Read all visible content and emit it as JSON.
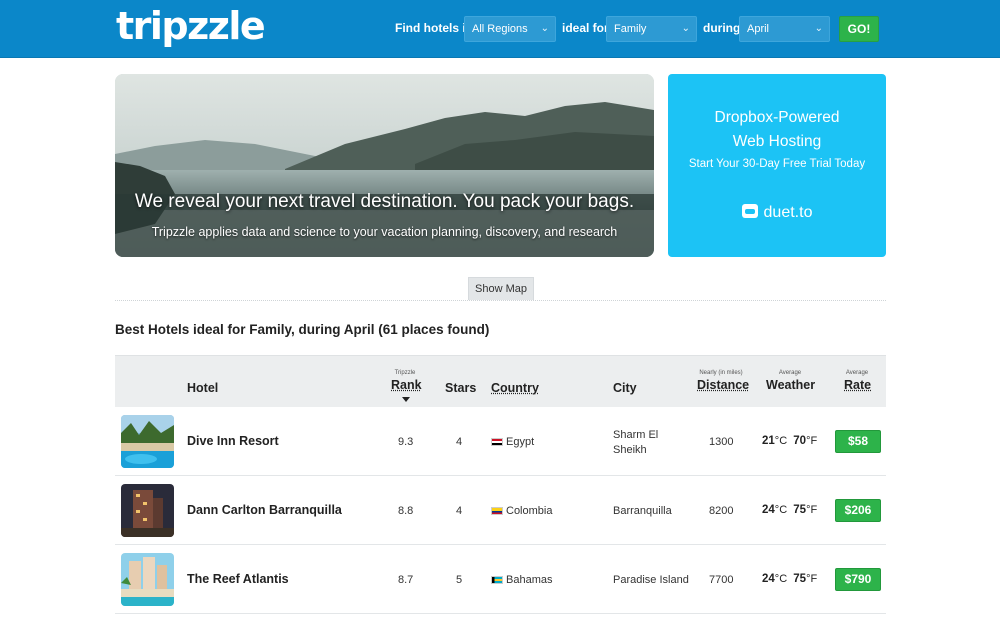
{
  "header": {
    "logo": "tripzzle",
    "find_label": "Find hotels in",
    "region_value": "All Regions",
    "ideal_label": "ideal for",
    "ideal_value": "Family",
    "during_label": "during",
    "month_value": "April",
    "go_label": "GO!"
  },
  "hero": {
    "title": "We reveal your next travel destination. You pack your bags.",
    "subtitle": "Tripzzle applies data and science to your vacation planning, discovery, and research"
  },
  "ad": {
    "title_line1": "Dropbox-Powered",
    "title_line2": "Web Hosting",
    "subtitle": "Start Your 30-Day Free Trial Today",
    "brand": "duet.to"
  },
  "show_map_label": "Show Map",
  "results_title": "Best Hotels ideal for Family, during April (61 places found)",
  "table": {
    "headers": {
      "hotel": "Hotel",
      "rank_small": "Tripzzle",
      "rank": "Rank",
      "stars": "Stars",
      "country": "Country",
      "city": "City",
      "distance_small": "Nearly (in miles)",
      "distance": "Distance",
      "weather_small": "Average",
      "weather": "Weather",
      "rate_small": "Average",
      "rate": "Rate"
    },
    "rows": [
      {
        "name": "Dive Inn Resort",
        "rank": "9.3",
        "stars": "4",
        "country": "Egypt",
        "city_line1": "Sharm El",
        "city_line2": "Sheikh",
        "distance": "1300",
        "temp_c": "21",
        "unit_c": "°C",
        "temp_f": "70",
        "unit_f": "°F",
        "rate": "$58"
      },
      {
        "name": "Dann Carlton Barranquilla",
        "rank": "8.8",
        "stars": "4",
        "country": "Colombia",
        "city_line1": "Barranquilla",
        "city_line2": "",
        "distance": "8200",
        "temp_c": "24",
        "unit_c": "°C",
        "temp_f": "75",
        "unit_f": "°F",
        "rate": "$206"
      },
      {
        "name": "The Reef Atlantis",
        "rank": "8.7",
        "stars": "5",
        "country": "Bahamas",
        "city_line1": "Paradise Island",
        "city_line2": "",
        "distance": "7700",
        "temp_c": "24",
        "unit_c": "°C",
        "temp_f": "75",
        "unit_f": "°F",
        "rate": "$790"
      }
    ]
  },
  "colors": {
    "header_bg": "#0b87c9",
    "go_green": "#2db34a",
    "ad_blue": "#1cc3f5"
  }
}
